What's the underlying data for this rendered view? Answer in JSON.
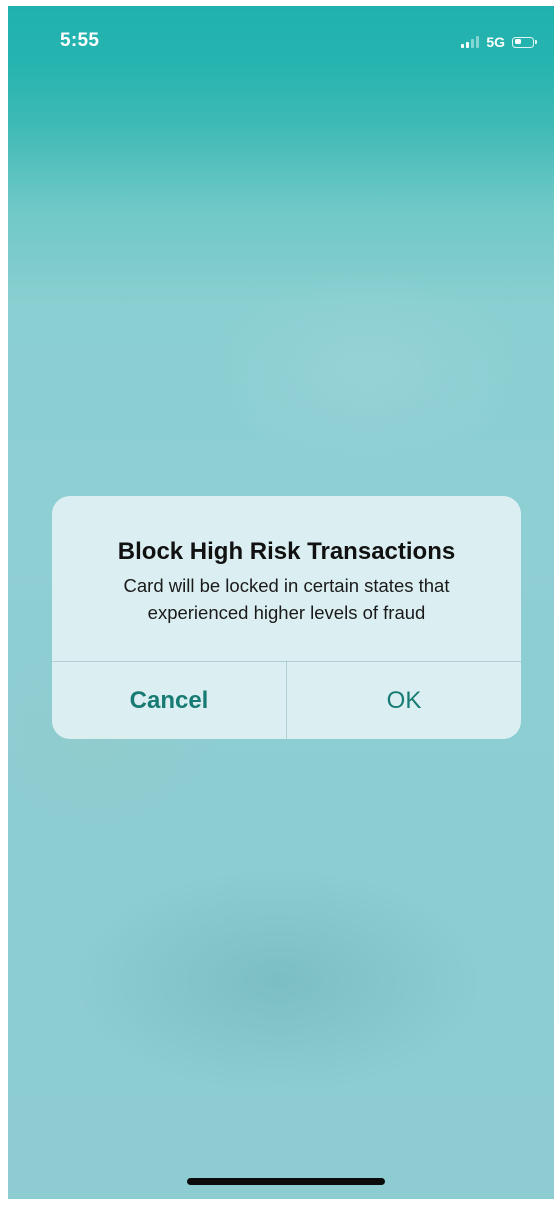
{
  "status_bar": {
    "time": "5:55",
    "network": "5G",
    "signal_bars_active": 2,
    "signal_bars_total": 4,
    "battery_level_percent": 40
  },
  "alert": {
    "title": "Block High Risk Transactions",
    "message": "Card will be locked in certain states that experienced higher levels of fraud",
    "cancel_label": "Cancel",
    "ok_label": "OK"
  },
  "colors": {
    "accent": "#177b74",
    "top_background": "#20b1ae",
    "background": "#8dcdd2"
  },
  "icons": {
    "signal": "cellular-signal-icon",
    "battery": "battery-icon"
  }
}
